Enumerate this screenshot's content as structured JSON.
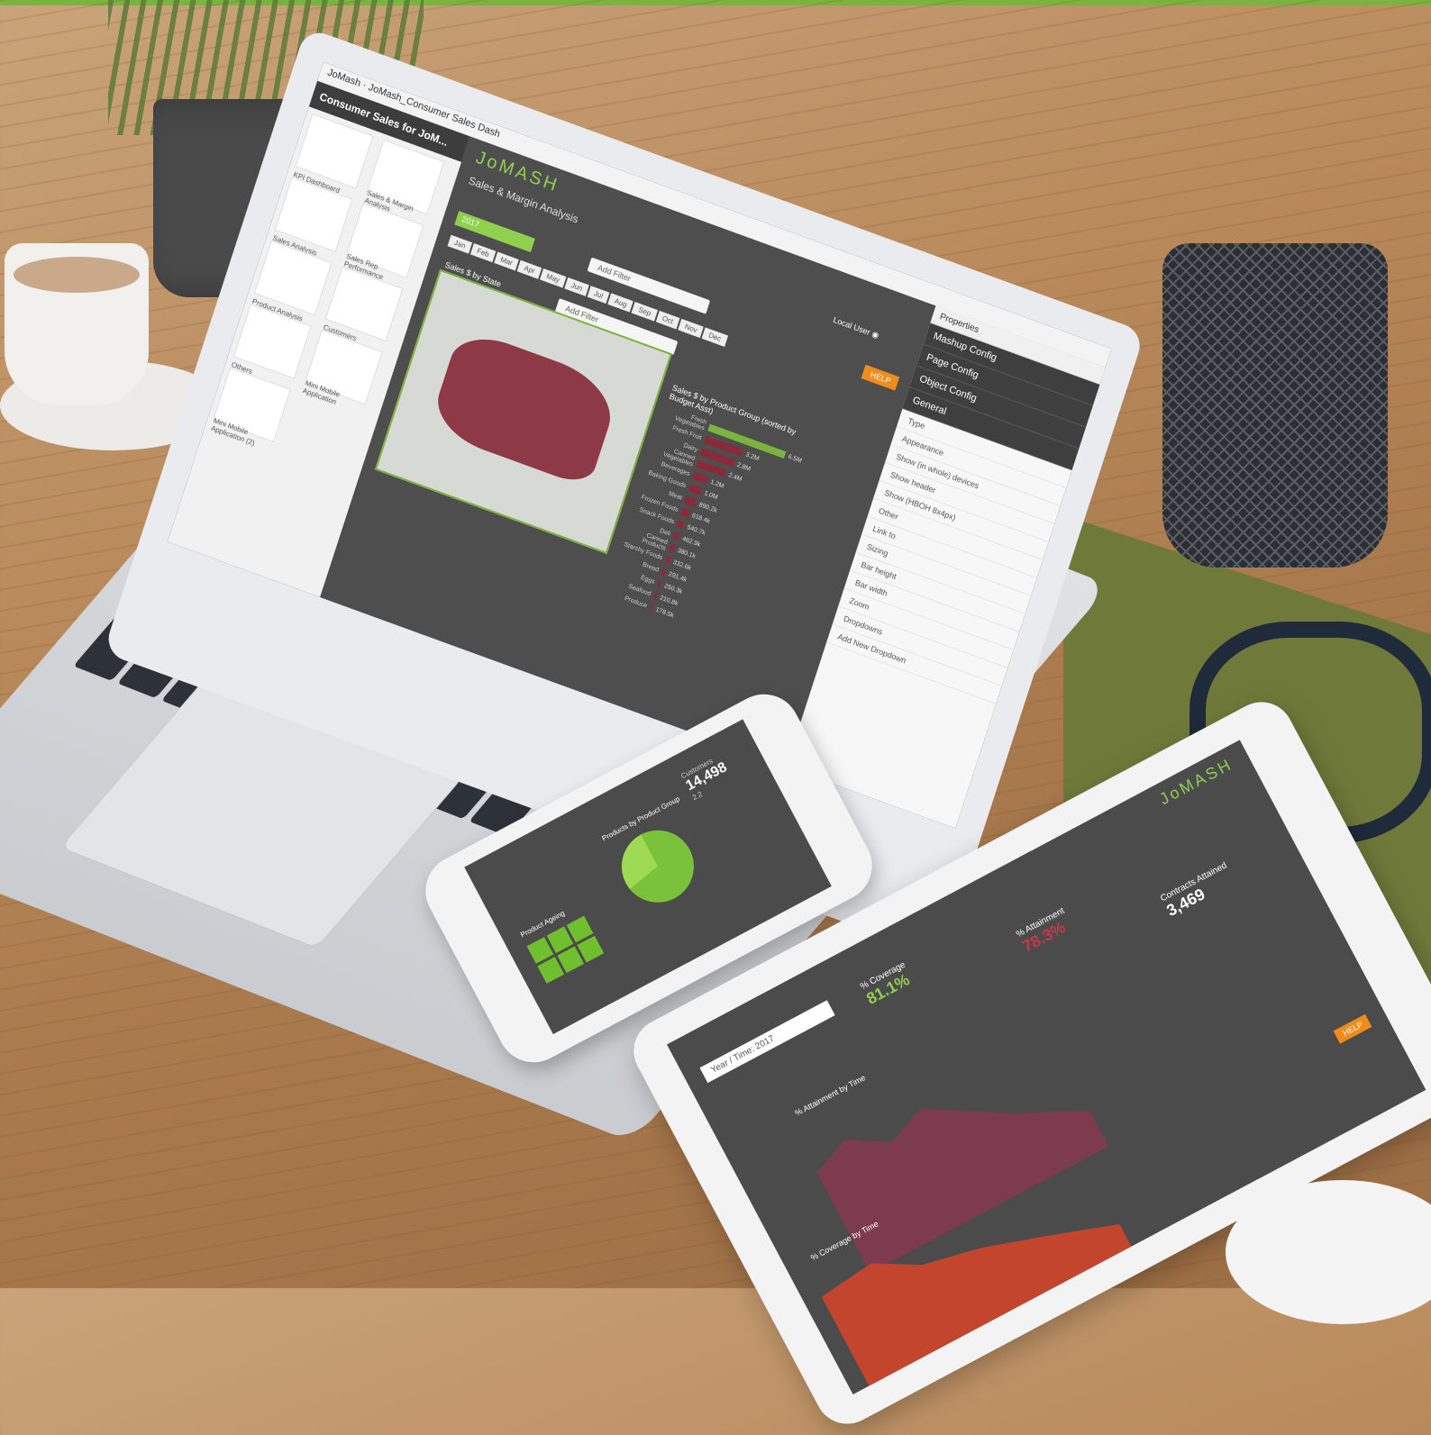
{
  "theme": {
    "accent": "#7ab43f",
    "help": "#f08c1e",
    "map_fill": "#8e3a46",
    "bar_fill": "#8e2838"
  },
  "laptop": {
    "window_title": "JoMash",
    "breadcrumb": "JoMash_Consumer Sales Dash",
    "sidebar_title": "Consumer Sales for JoM...",
    "thumbnails": [
      "KPI Dashboard",
      "Sales & Margin Analysis",
      "Sales Analysis",
      "Sales Rep Performance",
      "Product Analysis",
      "Customers",
      "Others",
      "Mini Mobile Application",
      "Mini Mobile Application (2)"
    ],
    "brand": "JoMASH",
    "page_title": "Sales & Margin Analysis",
    "add_filter_1": "Add Filter",
    "add_filter_2": "Add Filter",
    "year_chip": "2017",
    "months": [
      "Jan",
      "Feb",
      "Mar",
      "Apr",
      "May",
      "Jun",
      "Jul",
      "Aug",
      "Sep",
      "Oct",
      "Nov",
      "Dec"
    ],
    "map_title": "Sales $ by State",
    "bars_title": "Sales $ by Product Group (sorted by Budget Asst)",
    "user_name": "Local User",
    "help_label": "HELP",
    "properties": {
      "header": "Properties",
      "sections": [
        "Mashup Config",
        "Page Config",
        "Object Config",
        "General"
      ],
      "rows": [
        "Type",
        "Appearance",
        "Show (in whole) devices",
        "Show header",
        "Show (HBOH 8x4px)",
        "Other",
        "Link to",
        "Sizing",
        "Bar height",
        "Bar width",
        "Zoom",
        "Dropdowns",
        "Add New Dropdown"
      ]
    }
  },
  "chart_data": {
    "type": "bar",
    "title": "Sales $ by Product Group (sorted by Budget Asst)",
    "categories": [
      "Fresh Vegetables",
      "Fresh Fruit",
      "Dairy",
      "Canned Vegetables",
      "Beverages",
      "Baking Goods",
      "Meat",
      "Frozen Foods",
      "Snack Foods",
      "Deli",
      "Canned Products",
      "Starchy Foods",
      "Bread",
      "Eggs",
      "Seafood",
      "Produce"
    ],
    "values": [
      6.5,
      3.2,
      2.8,
      2.4,
      1.2,
      1.0,
      0.89,
      0.62,
      0.54,
      0.46,
      0.38,
      0.33,
      0.29,
      0.25,
      0.21,
      0.18
    ],
    "value_labels": [
      "6.5M",
      "3.2M",
      "2.8M",
      "2.4M",
      "1.2M",
      "1.0M",
      "890.2k",
      "618.4k",
      "540.7k",
      "462.9k",
      "380.1k",
      "332.6k",
      "291.4k",
      "250.3k",
      "210.8k",
      "178.5k"
    ]
  },
  "phone": {
    "kpi_value": "14,498",
    "kpi_label": "Customers",
    "kpi_value_2": "2.2",
    "pie_title": "Products by Product Group",
    "tiles_title": "Product Ageing"
  },
  "tablet": {
    "brand": "JoMASH",
    "time_label": "Year / Time",
    "time_value": "2017",
    "kpi1_label": "% Coverage",
    "kpi1_value": "81.1%",
    "kpi2_label": "% Attainment",
    "kpi2_value": "78.3%",
    "kpi3_label": "Contracts Attained",
    "kpi3_value": "3,469",
    "chart1_title": "% Attainment by Time",
    "chart2_title": "% Coverage by Time",
    "help_label": "HELP"
  }
}
